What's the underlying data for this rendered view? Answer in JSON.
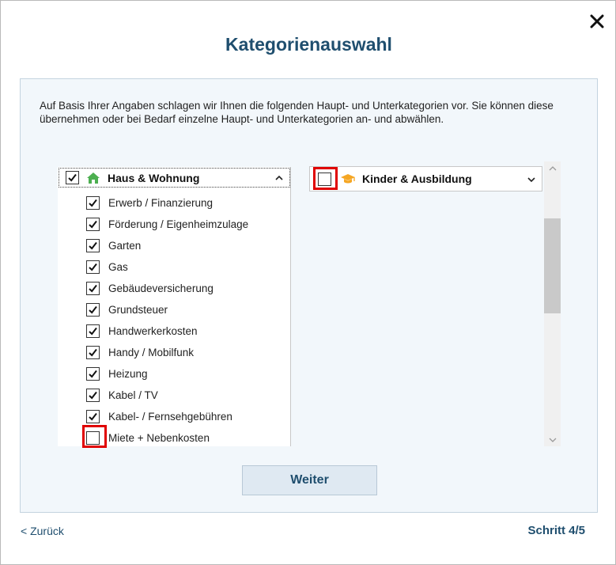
{
  "dialog": {
    "title": "Kategorienauswahl",
    "intro": "Auf Basis Ihrer Angaben schlagen wir Ihnen die folgenden Haupt- und Unterkategorien vor. Sie können diese übernehmen oder bei Bedarf einzelne Haupt- und Unterkategorien an- und abwählen.",
    "close_icon": "close-icon"
  },
  "categories": {
    "left": {
      "label": "Haus & Wohnung",
      "checked": true,
      "icon": "house-icon",
      "icon_color": "#4caf50",
      "expanded": true,
      "items": [
        {
          "label": "Erwerb / Finanzierung",
          "checked": true
        },
        {
          "label": "Förderung / Eigenheimzulage",
          "checked": true
        },
        {
          "label": "Garten",
          "checked": true
        },
        {
          "label": "Gas",
          "checked": true
        },
        {
          "label": "Gebäudeversicherung",
          "checked": true
        },
        {
          "label": "Grundsteuer",
          "checked": true
        },
        {
          "label": "Handwerkerkosten",
          "checked": true
        },
        {
          "label": "Handy / Mobilfunk",
          "checked": true
        },
        {
          "label": "Heizung",
          "checked": true
        },
        {
          "label": "Kabel / TV",
          "checked": true
        },
        {
          "label": "Kabel- / Fernsehgebühren",
          "checked": true
        },
        {
          "label": "Miete + Nebenkosten",
          "checked": false
        }
      ]
    },
    "right": {
      "label": "Kinder & Ausbildung",
      "checked": false,
      "icon": "graduation-cap-icon",
      "icon_color": "#f5a623",
      "expanded": false
    }
  },
  "colors": {
    "accent": "#1f4e6e",
    "highlight": "#e00000",
    "panel_bg": "#f2f7fb"
  },
  "footer": {
    "next_label": "Weiter",
    "back_label": "< Zurück",
    "step_label": "Schritt 4/5"
  }
}
